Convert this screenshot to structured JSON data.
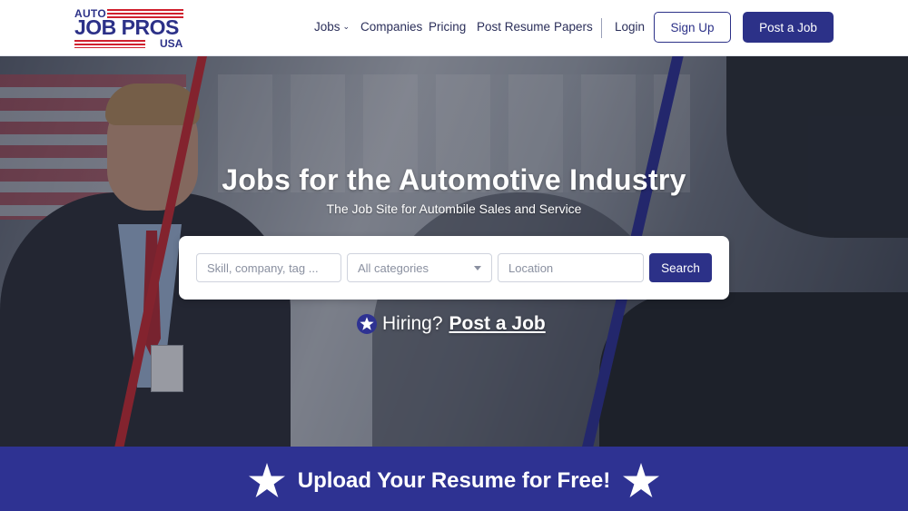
{
  "brand": {
    "logo_top": "AUTO",
    "logo_main": "JOB PROS",
    "logo_bottom": "USA"
  },
  "nav": {
    "jobs": "Jobs",
    "companies": "Companies",
    "pricing": "Pricing",
    "post_resume": "Post Resume",
    "papers": "Papers",
    "login": "Login",
    "sign_up": "Sign Up",
    "post_job": "Post a Job"
  },
  "hero": {
    "title": "Jobs for the Automotive Industry",
    "subtitle": "The Job Site for Autombile Sales and Service"
  },
  "search": {
    "skill_placeholder": "Skill, company, tag ...",
    "category_selected": "All categories",
    "location_placeholder": "Location",
    "button_label": "Search"
  },
  "hiring": {
    "prompt": "Hiring?",
    "link": "Post a Job"
  },
  "banner": {
    "text": "Upload Your Resume for Free!"
  },
  "colors": {
    "brand_blue": "#2c3188",
    "brand_red": "#d0202e",
    "banner_blue": "#2e3292"
  },
  "icons": {
    "nav_dropdown": "chevron-down-icon",
    "hiring_star": "star-icon",
    "banner_stars": "star-icon",
    "category_dropdown": "caret-down-icon"
  }
}
